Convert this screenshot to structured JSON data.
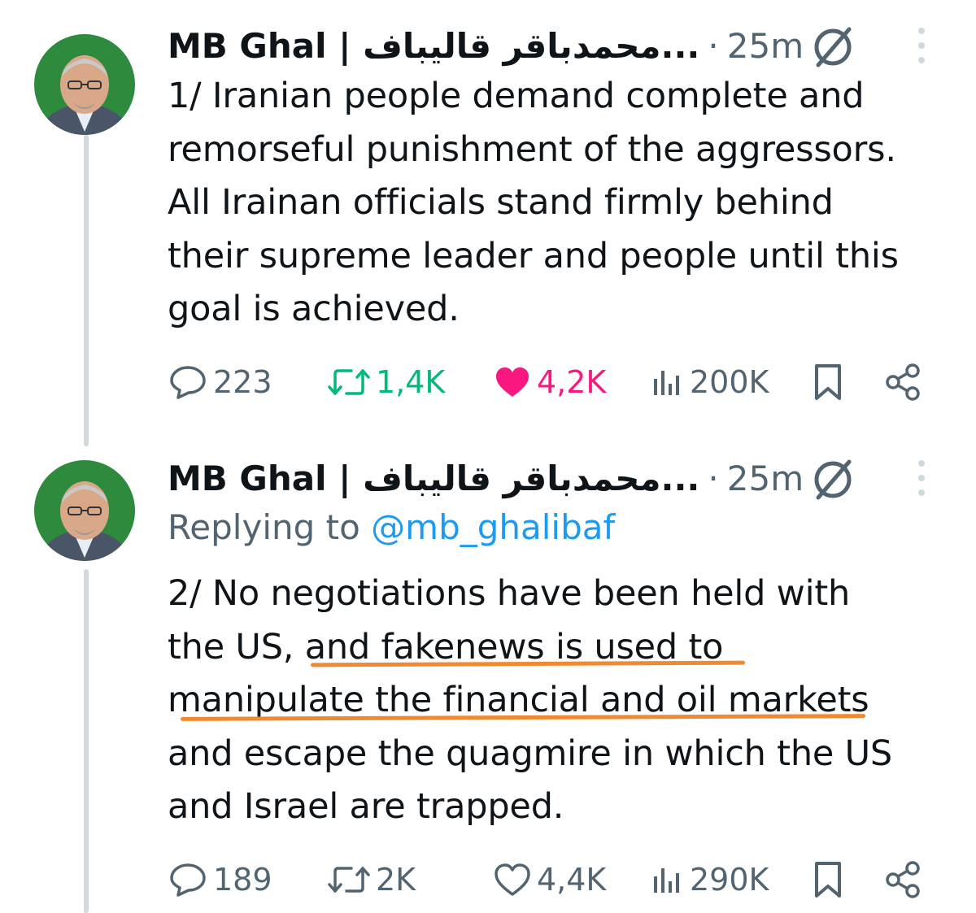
{
  "tweets": [
    {
      "display_name": "MB Ghal | محمدباقر قالیباف...",
      "separator": "·",
      "time": "25m",
      "replying_label": "",
      "replying_handle": "",
      "body_lines": [
        "1/ Iranian people demand complete and",
        "remorseful punishment of the aggressors.",
        "All Irainan officials stand firmly behind",
        "their supreme leader and people until this",
        "goal is achieved."
      ],
      "stats": {
        "replies": "223",
        "reposts": "1,4K",
        "likes": "4,2K",
        "views": "200K"
      },
      "reposted": true,
      "liked": true
    },
    {
      "display_name": "MB Ghal | محمدباقر قالیباف...",
      "separator": "·",
      "time": "25m",
      "replying_label": "Replying to",
      "replying_handle": "@mb_ghalibaf",
      "body_lines": [
        "2/ No negotiations have been held with",
        "the US, and fakenews is used to",
        "manipulate the financial and oil markets",
        "and escape the quagmire in which the US",
        "and Israel are trapped."
      ],
      "stats": {
        "replies": "189",
        "reposts": "2K",
        "likes": "4,4K",
        "views": "290K"
      },
      "reposted": false,
      "liked": false
    }
  ],
  "colors": {
    "text": "#0f1419",
    "secondary": "#536471",
    "link": "#1d9bf0",
    "repost_active": "#00ba7c",
    "like_active": "#f91880",
    "highlight_underline": "#f08a32",
    "thread_line": "#cfd9de",
    "avatar_bg": "#2e8b3e"
  },
  "icons": {
    "reply": "speech-bubble-icon",
    "repost": "repost-arrows-icon",
    "like": "heart-icon",
    "views": "bar-chart-icon",
    "bookmark": "bookmark-icon",
    "share": "share-icon",
    "verified": "verified-badge-icon",
    "more": "vertical-ellipsis-icon"
  }
}
